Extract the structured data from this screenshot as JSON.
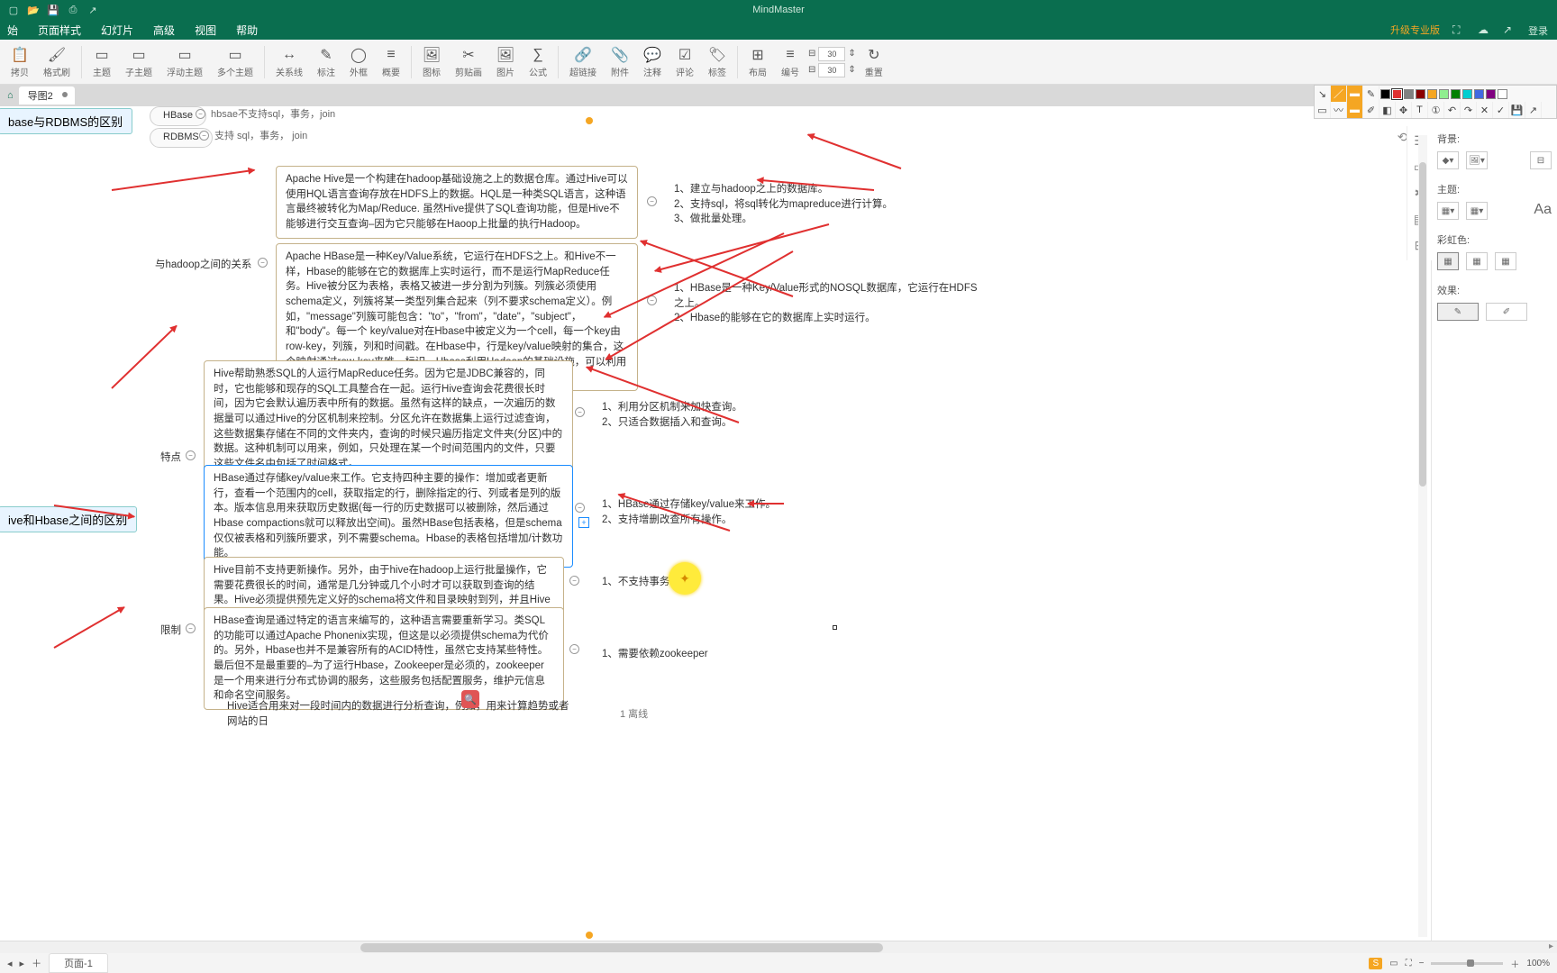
{
  "app": {
    "title": "MindMaster"
  },
  "menus": [
    "始",
    "页面样式",
    "幻灯片",
    "高级",
    "视图",
    "帮助"
  ],
  "upgrade_label": "升级专业版",
  "login_label": "登录",
  "ribbon": {
    "items": [
      {
        "icon": "📋",
        "label": "拷贝"
      },
      {
        "icon": "🖌",
        "label": "格式刷"
      },
      {
        "icon": "⬚",
        "label": "主题"
      },
      {
        "icon": "⬚",
        "label": "子主题"
      },
      {
        "icon": "⬚",
        "label": "浮动主题"
      },
      {
        "icon": "⬚",
        "label": "多个主题"
      },
      {
        "icon": "↔",
        "label": "关系线"
      },
      {
        "icon": "✎",
        "label": "标注"
      },
      {
        "icon": "◯",
        "label": "外框"
      },
      {
        "icon": "≡",
        "label": "概要"
      },
      {
        "icon": "🖼",
        "label": "图标"
      },
      {
        "icon": "✂",
        "label": "剪贴画"
      },
      {
        "icon": "🖼",
        "label": "图片"
      },
      {
        "icon": "∑",
        "label": "公式"
      },
      {
        "icon": "🔗",
        "label": "超链接"
      },
      {
        "icon": "📎",
        "label": "附件"
      },
      {
        "icon": "💬",
        "label": "注释"
      },
      {
        "icon": "☑",
        "label": "评论"
      },
      {
        "icon": "🏷",
        "label": "标签"
      },
      {
        "icon": "⊞",
        "label": "布局"
      },
      {
        "icon": "≡",
        "label": "编号"
      },
      {
        "icon": "↻",
        "label": "重置"
      }
    ],
    "width_label": "圕",
    "width_value": "30",
    "height_label": "丄",
    "height_value": "30"
  },
  "doctab": {
    "name": "导图2"
  },
  "rootnodes": {
    "r1": "base与RDBMS的区别",
    "r2": "ive和Hbase之间的区别"
  },
  "pills": {
    "hbase": "HBase",
    "hbase_right": "hbsae不支持sql，事务，join",
    "rdbms": "RDBMS",
    "rdbms_right": "支持 sql，事务， join",
    "hadoop_rel": "与hadoop之间的关系",
    "features": "特点",
    "limits": "限制"
  },
  "blocks": {
    "hive_intro": "Apache Hive是一个构建在hadoop基础设施之上的数据仓库。通过Hive可以使用HQL语言查询存放在HDFS上的数据。HQL是一种类SQL语言，这种语言最终被转化为Map/Reduce. 虽然Hive提供了SQL查询功能，但是Hive不能够进行交互查询–因为它只能够在Haoop上批量的执行Hadoop。",
    "hbase_intro": "Apache HBase是一种Key/Value系统，它运行在HDFS之上。和Hive不一样，Hbase的能够在它的数据库上实时运行，而不是运行MapReduce任务。Hive被分区为表格，表格又被进一步分割为列簇。列簇必须使用schema定义，列簇将某一类型列集合起来（列不要求schema定义）。例如，\"message\"列簇可能包含：\"to\"，\"from\"，\"date\"，\"subject\"，和\"body\"。每一个 key/value对在Hbase中被定义为一个cell，每一个key由row-key，列簇，列和时间戳。在Hbase中，行是key/value映射的集合，这个映射通过row-key来唯一标识。Hbase利用Hadoop的基础设施，可以利用通用的设备进行水平的扩展。",
    "hive_feat": "Hive帮助熟悉SQL的人运行MapReduce任务。因为它是JDBC兼容的，同时，它也能够和现存的SQL工具整合在一起。运行Hive查询会花费很长时间，因为它会默认遍历表中所有的数据。虽然有这样的缺点，一次遍历的数据量可以通过Hive的分区机制来控制。分区允许在数据集上运行过滤查询，这些数据集存储在不同的文件夹内，查询的时候只遍历指定文件夹(分区)中的数据。这种机制可以用来，例如，只处理在某一个时间范围内的文件，只要这些文件名中包括了时间格式。",
    "hbase_feat": "HBase通过存储key/value来工作。它支持四种主要的操作：增加或者更新行，查看一个范围内的cell，获取指定的行，删除指定的行、列或者是列的版本。版本信息用来获取历史数据(每一行的历史数据可以被删除，然后通过Hbase compactions就可以释放出空间)。虽然HBase包括表格，但是schema仅仅被表格和列簇所要求，列不需要schema。Hbase的表格包括增加/计数功能。",
    "hive_limit": "Hive目前不支持更新操作。另外，由于hive在hadoop上运行批量操作，它需要花费很长的时间，通常是几分钟或几个小时才可以获取到查询的结果。Hive必须提供预先定义好的schema将文件和目录映射到列，并且Hive与ACID不兼容。",
    "hbase_limit": "HBase查询是通过特定的语言来编写的，这种语言需要重新学习。类SQL的功能可以通过Apache Phonenix实现，但这是以必须提供schema为代价的。另外，Hbase也并不是兼容所有的ACID特性，虽然它支持某些特性。最后但不是最重要的–为了运行Hbase，Zookeeper是必须的，zookeeper是一个用来进行分布式协调的服务，这些服务包括配置服务，维护元信息和命名空间服务。",
    "footer": "Hive适合用来对一段时间内的数据进行分析查询，例如，用来计算趋势或者网站的日"
  },
  "rightlists": {
    "hive_pts": [
      "1、建立与hadoop之上的数据库。",
      "2、支持sql，将sql转化为mapreduce进行计算。",
      "3、做批量处理。"
    ],
    "hbase_pts": [
      "1、HBase是一种Key/Value形式的NOSQL数据库，它运行在HDFS之上。",
      "2、Hbase的能够在它的数据库上实时运行。"
    ],
    "hive_feat_pts": [
      "1、利用分区机制来加快查询。",
      "2、只适合数据插入和查询。"
    ],
    "hbase_feat_pts": [
      "1、HBase通过存储key/value来工作。",
      "2、支持增删改查所有操作。"
    ],
    "hive_limit_pts": [
      "1、不支持事务"
    ],
    "hbase_limit_pts": [
      "1、需要依赖zookeeper"
    ],
    "footer_pts": [
      "1  离线"
    ]
  },
  "rightpanel": {
    "sections": {
      "bg": "背景:",
      "theme": "主题:",
      "rainbow": "彩虹色:",
      "effect": "效果:"
    },
    "bigA": "Aa"
  },
  "pagetab": "页面-1",
  "zoom": "100%",
  "dim_nums": {
    "w": "30",
    "h": "30"
  }
}
